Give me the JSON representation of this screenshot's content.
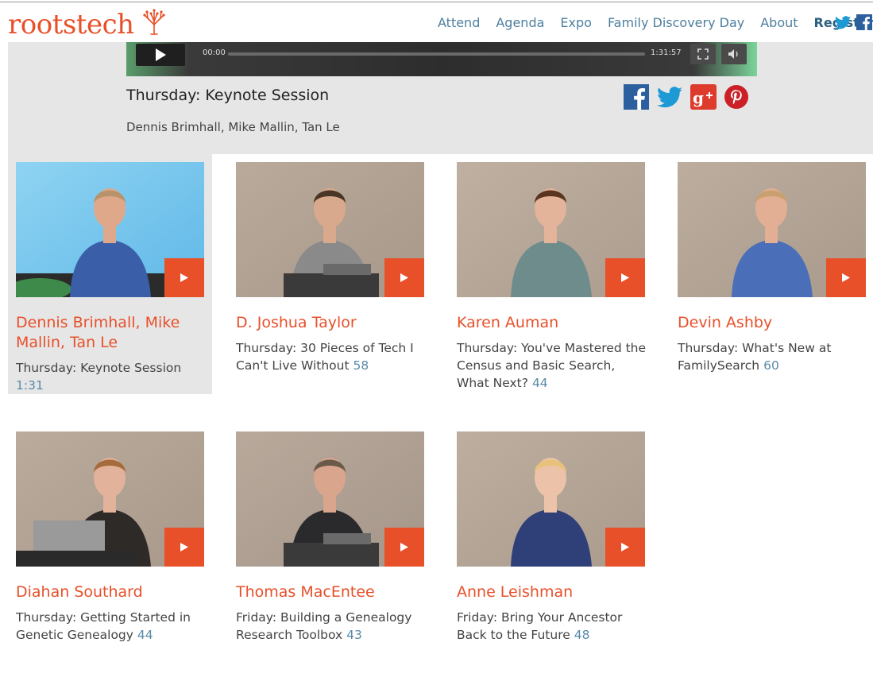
{
  "brand": {
    "logo_text": "rootstech"
  },
  "nav": {
    "items": [
      "Attend",
      "Agenda",
      "Expo",
      "Family Discovery Day",
      "About"
    ],
    "register": "Register"
  },
  "player": {
    "time_current": "00:00",
    "time_total": "1:31:57",
    "progress": 0
  },
  "feature": {
    "title": "Thursday: Keynote Session",
    "speakers": "Dennis Brimhall, Mike Mallin, Tan Le"
  },
  "colors": {
    "accent": "#e8502a",
    "link": "#4d7f9e",
    "duration": "#5a8aa8",
    "panel_bg": "#e6e6e6"
  },
  "cards": [
    {
      "name": "Dennis Brimhall, Mike Mallin, Tan Le",
      "session": "Thursday: Keynote Session",
      "duration": "1:31",
      "active": true
    },
    {
      "name": "D. Joshua Taylor",
      "session": "Thursday: 30 Pieces of Tech I Can't Live Without",
      "duration": "58"
    },
    {
      "name": "Karen Auman",
      "session": "Thursday: You've Mastered the Census and Basic Search, What Next?",
      "duration": "44"
    },
    {
      "name": "Devin Ashby",
      "session": "Thursday: What's New at FamilySearch",
      "duration": "60"
    },
    {
      "name": "Diahan Southard",
      "session": "Thursday: Getting Started in Genetic Genealogy",
      "duration": "44"
    },
    {
      "name": "Thomas MacEntee",
      "session": "Friday: Building a Genealogy Research Toolbox",
      "duration": "43"
    },
    {
      "name": "Anne Leishman",
      "session": "Friday: Bring Your Ancestor Back to the Future",
      "duration": "48"
    }
  ]
}
